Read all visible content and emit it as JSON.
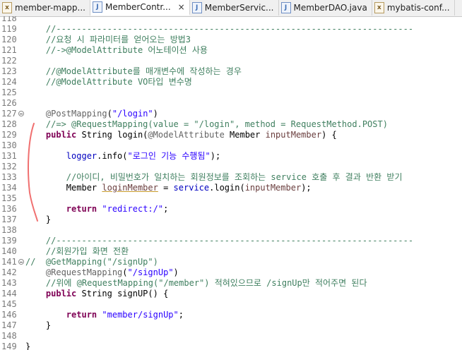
{
  "tabs": [
    {
      "label": "member-mapp...",
      "icon": "xml-file-icon",
      "active": false
    },
    {
      "label": "MemberContr...",
      "icon": "java-file-icon",
      "active": true,
      "close": "×"
    },
    {
      "label": "MemberServic...",
      "icon": "java-file-icon",
      "active": false
    },
    {
      "label": "MemberDAO.java",
      "icon": "java-file-icon",
      "active": false
    },
    {
      "label": "mybatis-conf...",
      "icon": "xml-file-icon",
      "active": false
    }
  ],
  "tab_icon_glyph": {
    "java": "J",
    "xml": "x"
  },
  "lines": [
    {
      "n": "118",
      "tokens": []
    },
    {
      "n": "119",
      "tokens": [
        {
          "t": "    //----------------------------------------------------------------------",
          "c": "cm"
        }
      ]
    },
    {
      "n": "120",
      "tokens": [
        {
          "t": "    //요청 시 파라미터를 얻어오는 방법3",
          "c": "cm"
        }
      ]
    },
    {
      "n": "121",
      "tokens": [
        {
          "t": "    //->@ModelAttribute 어노테이션 사용",
          "c": "cm"
        }
      ]
    },
    {
      "n": "122",
      "tokens": []
    },
    {
      "n": "123",
      "tokens": [
        {
          "t": "    //@ModelAttribute를 매개변수에 작성하는 경우",
          "c": "cm"
        }
      ]
    },
    {
      "n": "124",
      "tokens": [
        {
          "t": "    //@ModelAttribute VO타입 변수명",
          "c": "cm"
        }
      ]
    },
    {
      "n": "125",
      "tokens": []
    },
    {
      "n": "126",
      "tokens": []
    },
    {
      "n": "127",
      "fold": true,
      "tokens": [
        {
          "t": "    ",
          "c": "pl"
        },
        {
          "t": "@PostMapping",
          "c": "an"
        },
        {
          "t": "(",
          "c": "pl"
        },
        {
          "t": "\"/login\"",
          "c": "st"
        },
        {
          "t": ")",
          "c": "pl"
        }
      ]
    },
    {
      "n": "128",
      "tokens": [
        {
          "t": "    //=> @RequestMapping(value = \"/login\", method = RequestMethod.POST)",
          "c": "cm"
        }
      ]
    },
    {
      "n": "129",
      "tokens": [
        {
          "t": "    ",
          "c": "pl"
        },
        {
          "t": "public",
          "c": "kw"
        },
        {
          "t": " String login(",
          "c": "pl"
        },
        {
          "t": "@ModelAttribute",
          "c": "an"
        },
        {
          "t": " Member ",
          "c": "pl"
        },
        {
          "t": "inputMember",
          "c": "pa"
        },
        {
          "t": ") {",
          "c": "pl"
        }
      ]
    },
    {
      "n": "130",
      "tokens": []
    },
    {
      "n": "131",
      "tokens": [
        {
          "t": "        ",
          "c": "pl"
        },
        {
          "t": "logger",
          "c": "fd"
        },
        {
          "t": ".info(",
          "c": "pl"
        },
        {
          "t": "\"로그인 기능 수행됨\"",
          "c": "st"
        },
        {
          "t": ");",
          "c": "pl"
        }
      ]
    },
    {
      "n": "132",
      "tokens": []
    },
    {
      "n": "133",
      "tokens": [
        {
          "t": "        //아이디, 비밀번호가 일치하는 회원정보를 조회하는 service 호출 후 결과 반환 받기",
          "c": "cm"
        }
      ]
    },
    {
      "n": "134",
      "tokens": [
        {
          "t": "        Member ",
          "c": "pl"
        },
        {
          "t": "loginMember",
          "c": "pa ul"
        },
        {
          "t": " = ",
          "c": "pl"
        },
        {
          "t": "service",
          "c": "fd"
        },
        {
          "t": ".login(",
          "c": "pl"
        },
        {
          "t": "inputMember",
          "c": "pa"
        },
        {
          "t": ");",
          "c": "pl"
        }
      ]
    },
    {
      "n": "135",
      "tokens": []
    },
    {
      "n": "136",
      "tokens": [
        {
          "t": "        ",
          "c": "pl"
        },
        {
          "t": "return",
          "c": "kw"
        },
        {
          "t": " ",
          "c": "pl"
        },
        {
          "t": "\"redirect:/\"",
          "c": "st"
        },
        {
          "t": ";",
          "c": "pl"
        }
      ]
    },
    {
      "n": "137",
      "tokens": [
        {
          "t": "    }",
          "c": "pl"
        }
      ]
    },
    {
      "n": "138",
      "tokens": []
    },
    {
      "n": "139",
      "tokens": [
        {
          "t": "    //----------------------------------------------------------------------",
          "c": "cm"
        }
      ]
    },
    {
      "n": "140",
      "tokens": [
        {
          "t": "    //회원가입 화면 전환",
          "c": "cm"
        }
      ]
    },
    {
      "n": "141",
      "fold": true,
      "tokens": [
        {
          "t": "//  @GetMapping(\"/signUp\")",
          "c": "cm"
        }
      ]
    },
    {
      "n": "142",
      "tokens": [
        {
          "t": "    ",
          "c": "pl"
        },
        {
          "t": "@RequestMapping",
          "c": "an"
        },
        {
          "t": "(",
          "c": "pl"
        },
        {
          "t": "\"/signUp\"",
          "c": "st"
        },
        {
          "t": ")",
          "c": "pl"
        }
      ]
    },
    {
      "n": "143",
      "tokens": [
        {
          "t": "    //위에 @RequestMapping(\"/member\") 적혀있으므로 /signUp만 적어주면 된다",
          "c": "cm"
        }
      ]
    },
    {
      "n": "144",
      "tokens": [
        {
          "t": "    ",
          "c": "pl"
        },
        {
          "t": "public",
          "c": "kw"
        },
        {
          "t": " String signUP() {",
          "c": "pl"
        }
      ]
    },
    {
      "n": "145",
      "tokens": []
    },
    {
      "n": "146",
      "tokens": [
        {
          "t": "        ",
          "c": "pl"
        },
        {
          "t": "return",
          "c": "kw"
        },
        {
          "t": " ",
          "c": "pl"
        },
        {
          "t": "\"member/signUp\"",
          "c": "st"
        },
        {
          "t": ";",
          "c": "pl"
        }
      ]
    },
    {
      "n": "147",
      "tokens": [
        {
          "t": "    }",
          "c": "pl"
        }
      ]
    },
    {
      "n": "148",
      "tokens": []
    },
    {
      "n": "149",
      "tokens": [
        {
          "t": "}",
          "c": "pl"
        }
      ]
    }
  ],
  "colors": {
    "comment": "#3f7f5f",
    "keyword": "#7f0055",
    "annotation": "#646464",
    "string": "#2a00ff",
    "field": "#0000c0",
    "annotation_mark": "#f07070"
  }
}
